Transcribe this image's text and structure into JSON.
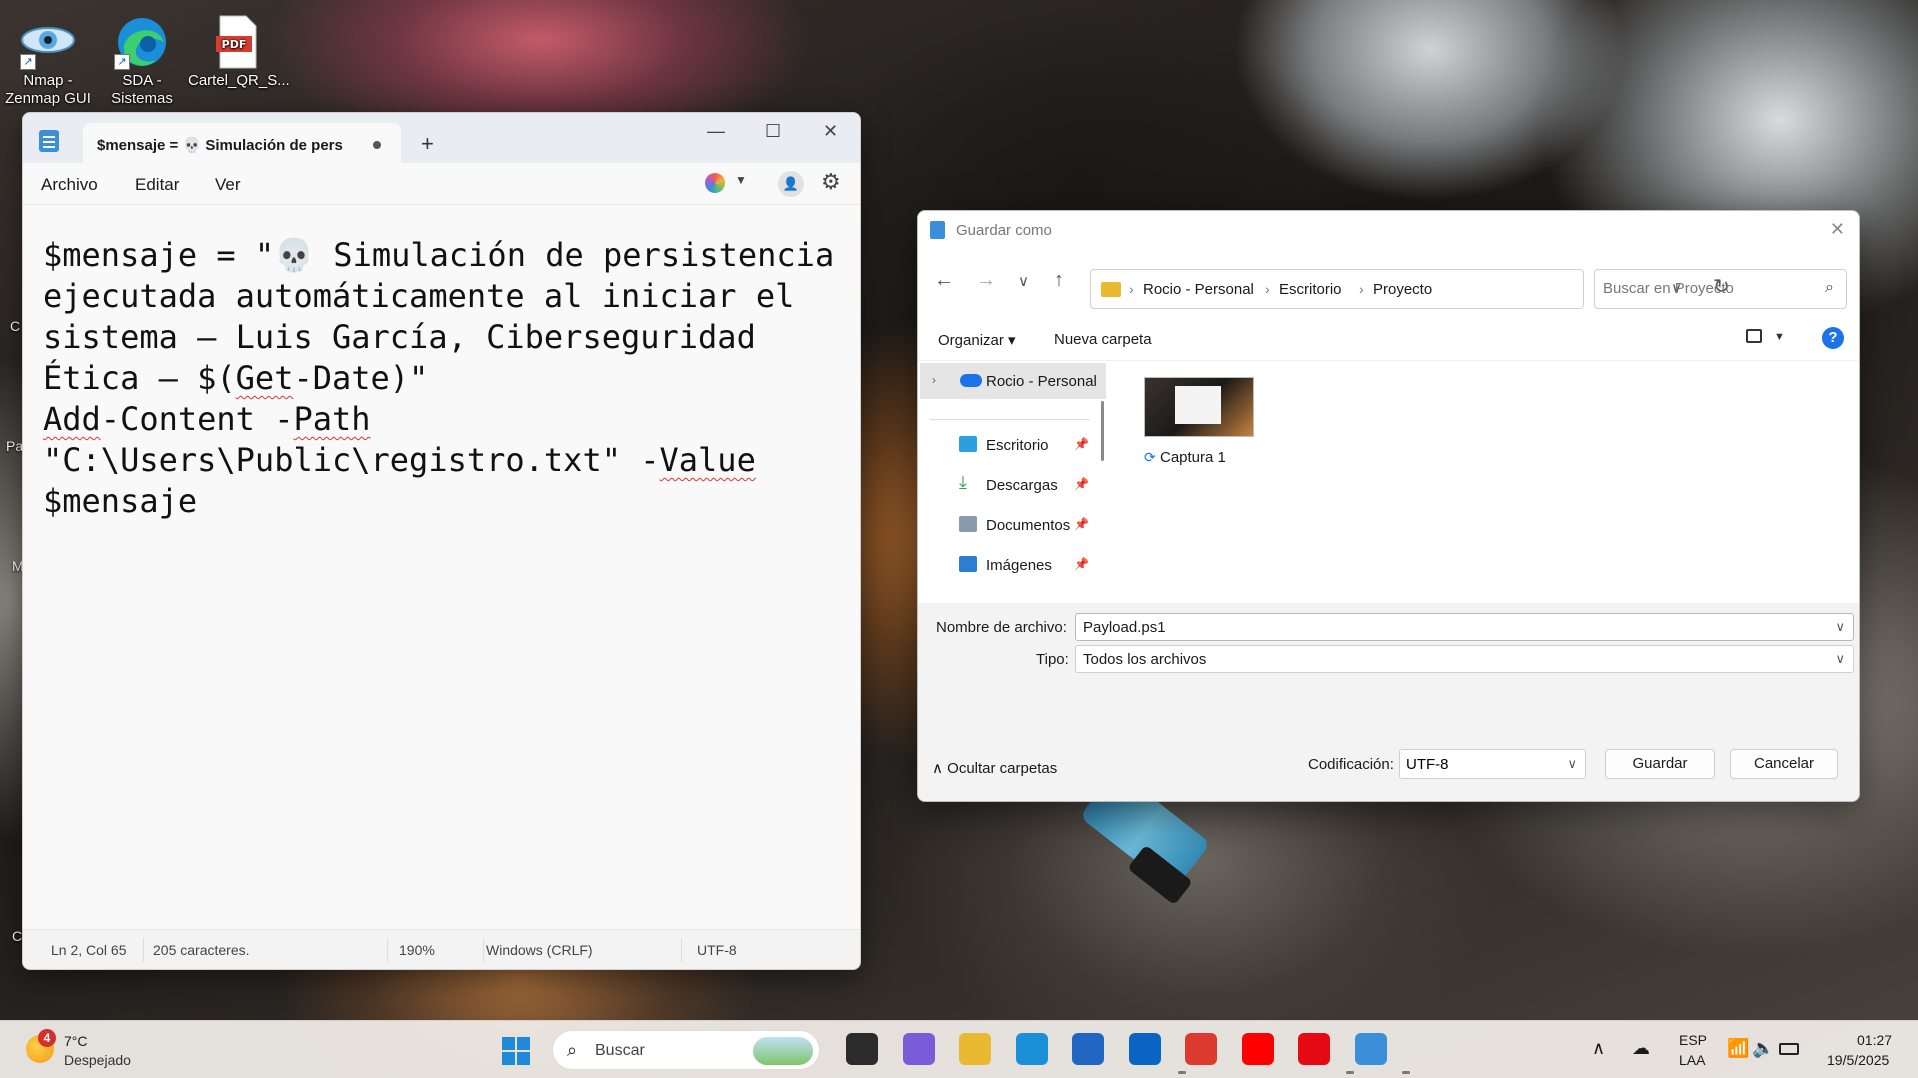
{
  "desktop": {
    "icons": [
      {
        "label": "Nmap - Zenmap GUI",
        "icon": "nmap-eye-icon"
      },
      {
        "label": "SDA - Sistemas",
        "icon": "edge-icon"
      },
      {
        "label": "Cartel_QR_S...",
        "icon": "pdf-icon",
        "badge": "PDF"
      }
    ],
    "left_fragments": [
      "C",
      "Pa",
      "M",
      "C"
    ]
  },
  "notepad": {
    "tab_title": "$mensaje = 💀 Simulación de pers",
    "menu": [
      "Archivo",
      "Editar",
      "Ver"
    ],
    "account_glyph": "👤",
    "window_controls": {
      "minimize": "—",
      "maximize": "☐",
      "close": "✕"
    },
    "content_lines": [
      [
        {
          "t": "$mensaje = \"💀 Simulación de persistencia ejecutada automáticamente al iniciar el sistema — Luis García, Ciberseguridad Ética — $(",
          "sq": false
        },
        {
          "t": "Get",
          "sq": true
        },
        {
          "t": "-Date)\"",
          "sq": false
        }
      ],
      [
        {
          "t": "Add",
          "sq": true
        },
        {
          "t": "-Content -",
          "sq": false
        },
        {
          "t": "Path",
          "sq": true
        },
        {
          "t": " \"C:\\Users\\Public\\registro.txt\" -",
          "sq": false
        },
        {
          "t": "Value",
          "sq": true
        },
        {
          "t": " $mensaje",
          "sq": false
        }
      ]
    ],
    "status": {
      "position": "Ln 2, Col 65",
      "chars": "205 caracteres.",
      "zoom": "190%",
      "line_endings": "Windows (CRLF)",
      "encoding": "UTF-8"
    }
  },
  "save_dialog": {
    "title": "Guardar como",
    "close": "✕",
    "address": [
      "Rocio - Personal",
      "Escritorio",
      "Proyecto"
    ],
    "search_placeholder": "Buscar en Proyecto",
    "toolbar": {
      "organize": "Organizar ▾",
      "new_folder": "Nueva carpeta",
      "help": "?"
    },
    "nav": [
      {
        "label": "Rocio - Personal",
        "icon": "onedrive-icon",
        "color": "#1a73e8"
      },
      {
        "label": "Escritorio",
        "icon": "desktop-icon",
        "color": "#2b9fe0",
        "pinned": true
      },
      {
        "label": "Descargas",
        "icon": "download-icon",
        "color": "#2e9d5a",
        "pinned": true
      },
      {
        "label": "Documentos",
        "icon": "documents-icon",
        "color": "#8a9aad",
        "pinned": true
      },
      {
        "label": "Imágenes",
        "icon": "pictures-icon",
        "color": "#2a7fd4",
        "pinned": true
      }
    ],
    "files": [
      {
        "name": "Captura 1",
        "sync": "⟳"
      }
    ],
    "filename_label": "Nombre de archivo:",
    "filename_value": "Payload.ps1",
    "type_label": "Tipo:",
    "type_value": "Todos los archivos",
    "hide_folders": "Ocultar carpetas",
    "encoding_label": "Codificación:",
    "encoding_value": "UTF-8",
    "save_button": "Guardar",
    "cancel_button": "Cancelar"
  },
  "taskbar": {
    "weather_badge": "4",
    "weather_temp": "7°C",
    "weather_desc": "Despejado",
    "search_label": "Buscar",
    "apps": [
      {
        "name": "task-view-icon",
        "color": "#2b2b2b"
      },
      {
        "name": "copilot-icon",
        "color": "#7a5cd8"
      },
      {
        "name": "file-explorer-icon",
        "color": "#e8b931"
      },
      {
        "name": "edge-icon",
        "color": "#1a8fd8"
      },
      {
        "name": "microsoft-store-icon",
        "color": "#2266c4"
      },
      {
        "name": "outlook-icon",
        "color": "#0a64c2"
      },
      {
        "name": "chrome-icon",
        "color": "#dd3b2f"
      },
      {
        "name": "youtube-icon",
        "color": "#ff0000"
      },
      {
        "name": "netflix-icon",
        "color": "#e50914"
      },
      {
        "name": "notepad-icon",
        "color": "#3a8fd8"
      }
    ],
    "lang_top": "ESP",
    "lang_bottom": "LAA",
    "time": "01:27",
    "date": "19/5/2025"
  }
}
